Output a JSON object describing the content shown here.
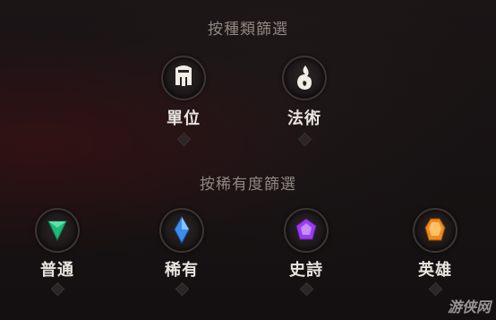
{
  "type_filter": {
    "title": "按種類篩選",
    "items": [
      {
        "label": "單位",
        "icon": "helmet-icon"
      },
      {
        "label": "法術",
        "icon": "flame-icon"
      }
    ]
  },
  "rarity_filter": {
    "title": "按稀有度篩選",
    "items": [
      {
        "label": "普通",
        "icon": "green-gem-icon",
        "color": "#1fb87a"
      },
      {
        "label": "稀有",
        "icon": "blue-gem-icon",
        "color": "#3a8ef0"
      },
      {
        "label": "史詩",
        "icon": "purple-gem-icon",
        "color": "#9a3cf0"
      },
      {
        "label": "英雄",
        "icon": "orange-gem-icon",
        "color": "#f08a1c"
      }
    ]
  },
  "watermark": "游侠网"
}
